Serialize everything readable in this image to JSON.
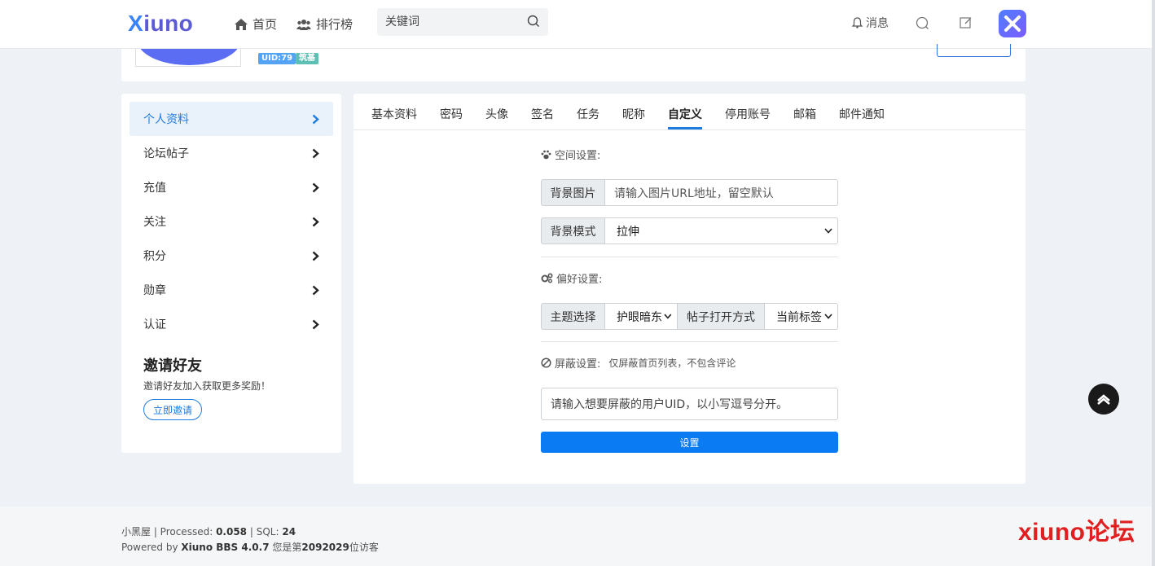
{
  "header": {
    "logo_x": "X",
    "logo_rest": "iuno",
    "nav_home": "首页",
    "nav_ranking": "排行榜",
    "search_placeholder": "关键词",
    "messages": "消息"
  },
  "profile": {
    "uid_badge": "UID:79",
    "level_badge": "筑基"
  },
  "sidebar": {
    "items": [
      {
        "label": "个人资料"
      },
      {
        "label": "论坛帖子"
      },
      {
        "label": "充值"
      },
      {
        "label": "关注"
      },
      {
        "label": "积分"
      },
      {
        "label": "勋章"
      },
      {
        "label": "认证"
      }
    ],
    "active_index": 0,
    "invite": {
      "title": "邀请好友",
      "desc": "邀请好友加入获取更多奖励！",
      "button": "立即邀请"
    }
  },
  "tabs": [
    "基本资料",
    "密码",
    "头像",
    "签名",
    "任务",
    "昵称",
    "自定义",
    "停用账号",
    "邮箱",
    "邮件通知"
  ],
  "active_tab": "自定义",
  "form": {
    "space_label": "空间设置:",
    "bg_image_label": "背景图片",
    "bg_image_placeholder": "请输入图片URL地址，留空默认",
    "bg_mode_label": "背景模式",
    "bg_mode_value": "拉伸",
    "pref_label": "偏好设置:",
    "theme_label": "主题选择",
    "theme_value": "护眼暗东",
    "open_mode_label": "帖子打开方式",
    "open_mode_value": "当前标签",
    "block_label": "屏蔽设置:",
    "block_note": "仅屏蔽首页列表，不包含评论",
    "block_placeholder": "请输入想要屏蔽的用户UID，以小写逗号分开。",
    "submit": "设置"
  },
  "footer": {
    "line1_prefix": "小黑屋 | Processed:",
    "processed": "0.058",
    "line1_sql": "| SQL:",
    "sql": "24",
    "line2_prefix": "Powered by",
    "engine": "Xiuno BBS 4.0.7",
    "line2_mid": "您是第",
    "visitors": "2092029",
    "line2_suffix": "位访客"
  },
  "watermark": "xiuno论坛",
  "colors": {
    "accent": "#1e7be0",
    "submit_bg": "#0b7bf3",
    "watermark": "#e02020"
  }
}
